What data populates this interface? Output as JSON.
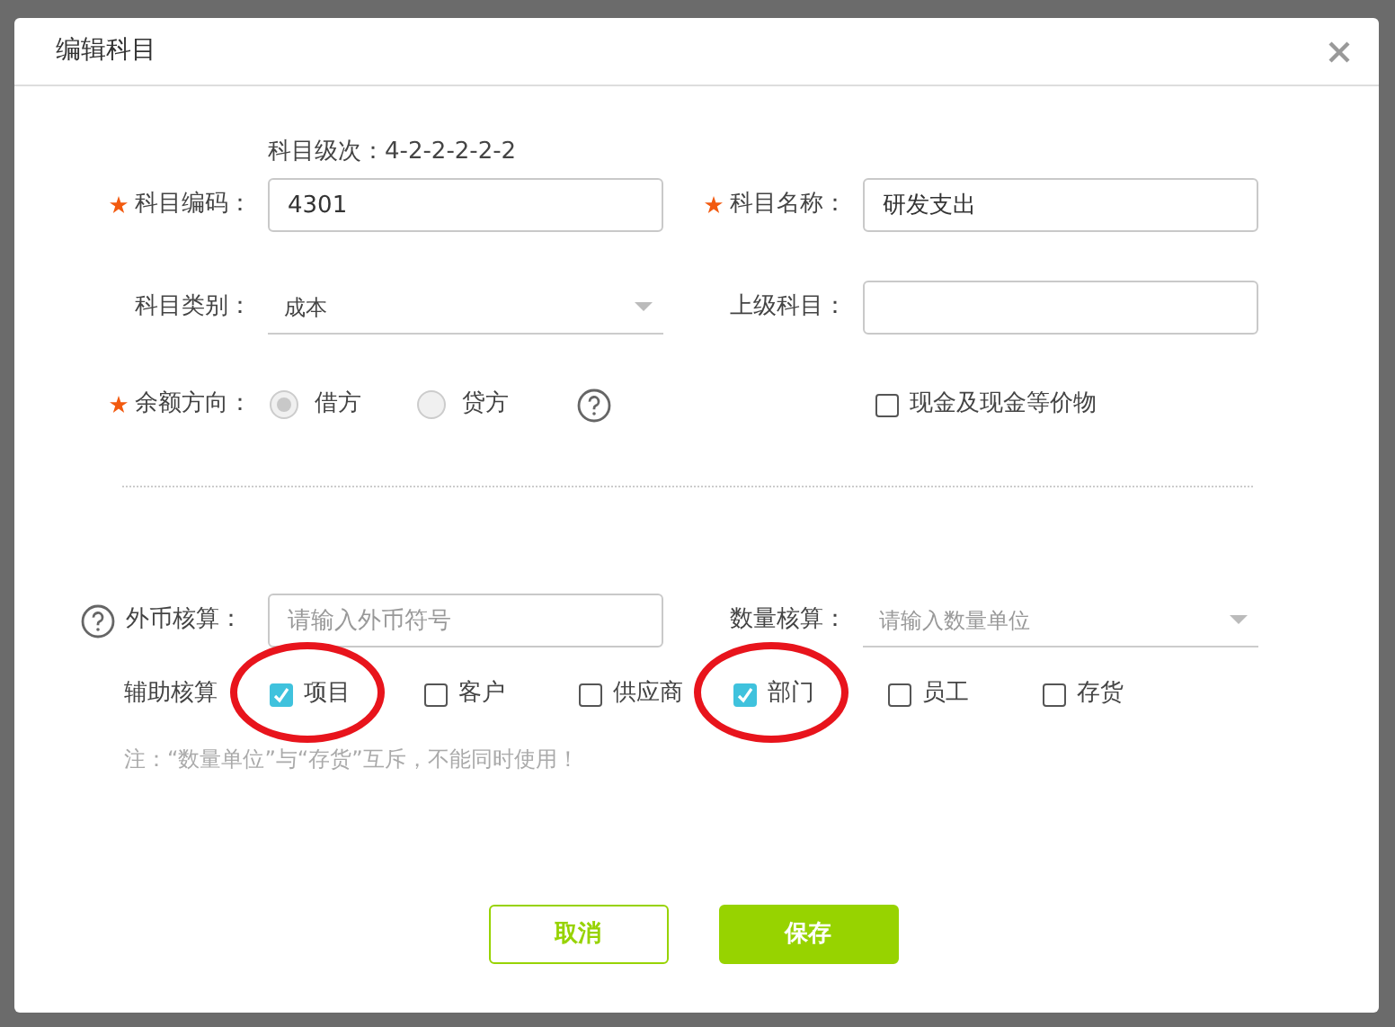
{
  "dialog": {
    "title": "编辑科目"
  },
  "code_hint": "科目级次：4-2-2-2-2-2",
  "subject_code": {
    "label": "科目编码：",
    "required": true,
    "value": "4301"
  },
  "subject_name": {
    "label": "科目名称：",
    "required": true,
    "value": "研发支出"
  },
  "subject_category": {
    "label": "科目类别：",
    "value": "成本"
  },
  "parent_subject": {
    "label": "上级科目："
  },
  "balance_direction": {
    "label": "余额方向：",
    "required": true,
    "options": [
      {
        "label": "借方",
        "selected": true
      },
      {
        "label": "贷方",
        "selected": false
      }
    ]
  },
  "cash_equivalent": {
    "label": "现金及现金等价物",
    "checked": false
  },
  "foreign_currency": {
    "label": "外币核算：",
    "placeholder": "请输入外币符号"
  },
  "quantity": {
    "label": "数量核算：",
    "placeholder": "请输入数量单位"
  },
  "auxiliary": {
    "label": "辅助核算",
    "options": [
      {
        "label": "项目",
        "checked": true,
        "circled": true
      },
      {
        "label": "客户",
        "checked": false,
        "circled": false
      },
      {
        "label": "供应商",
        "checked": false,
        "circled": false
      },
      {
        "label": "部门",
        "checked": true,
        "circled": true
      },
      {
        "label": "员工",
        "checked": false,
        "circled": false
      },
      {
        "label": "存货",
        "checked": false,
        "circled": false
      }
    ]
  },
  "note": "注：“数量单位”与“存货”互斥，不能同时使用！",
  "buttons": [
    {
      "label": "取消",
      "kind": "secondary"
    },
    {
      "label": "保存",
      "kind": "primary"
    }
  ]
}
